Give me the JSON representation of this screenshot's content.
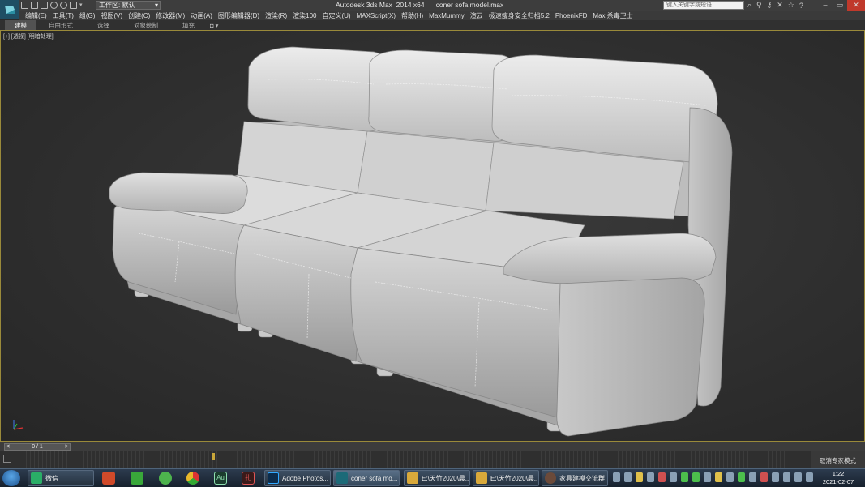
{
  "window": {
    "app_title": "Autodesk 3ds Max  2014 x64",
    "file_name": "coner sofa model.max",
    "workspace_label": "工作区: 默认",
    "search_placeholder": "键入关键字或短语"
  },
  "menu": [
    "编辑(E)",
    "工具(T)",
    "组(G)",
    "视图(V)",
    "创建(C)",
    "修改器(M)",
    "动画(A)",
    "图形编辑器(D)",
    "渲染(R)",
    "渲染100",
    "自定义(U)",
    "MAXScript(X)",
    "帮助(H)",
    "MaxMummy",
    "渲云",
    "极速瘦身安全归档5.2",
    "PhoenixFD",
    "Max 杀毒卫士"
  ],
  "ribbon_tabs": [
    "建模",
    "自由形式",
    "选择",
    "对象绘制",
    "填充"
  ],
  "viewport": {
    "label": "[+] [透视] [明暗处理]"
  },
  "timeline": {
    "frame_counter": "0 / 1",
    "prev": "<",
    "next": ">",
    "right_button": "取消专家模式"
  },
  "taskbar": {
    "apps": [
      {
        "label": "微信",
        "color": "#2aae67"
      },
      {
        "label": "Adobe Photos...",
        "color": "#0c2c4c"
      },
      {
        "label": "coner sofa mo...",
        "color": "#1c6a78"
      },
      {
        "label": "E:\\天竹2020\\晨...",
        "color": "#d9a93a"
      },
      {
        "label": "E:\\天竹2020\\晨...",
        "color": "#d9a93a"
      },
      {
        "label": "家具建模交流群",
        "color": "#6b4a3a"
      }
    ],
    "pinned_icons": [
      {
        "name": "cad-icon",
        "color": "#d04a2a",
        "glyph": "C"
      },
      {
        "name": "camtasia-icon",
        "color": "#39a83a",
        "glyph": "C"
      },
      {
        "name": "green-app-icon",
        "color": "#4db34d",
        "glyph": "●"
      },
      {
        "name": "chrome-icon",
        "color": "#e8b82a",
        "glyph": "◉"
      },
      {
        "name": "audition-icon",
        "color": "#1b3c2e",
        "glyph": "Au"
      },
      {
        "name": "kuaishou-icon",
        "color": "#c83a3a",
        "glyph": "扎"
      }
    ],
    "time": "1:22",
    "date": "2021-02-07"
  }
}
